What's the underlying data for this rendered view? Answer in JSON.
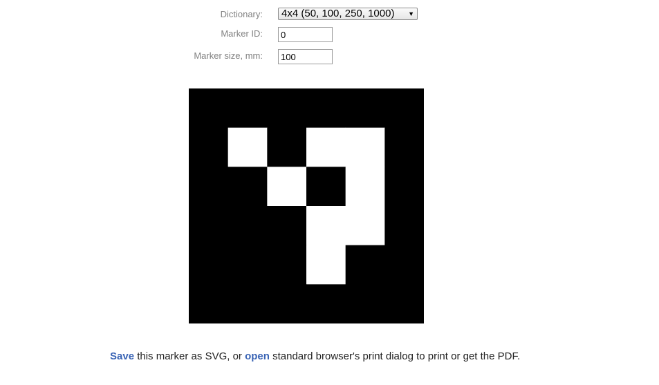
{
  "form": {
    "dictionary_label": "Dictionary:",
    "dictionary_value": "4x4 (50, 100, 250, 1000)",
    "marker_id_label": "Marker ID:",
    "marker_id_value": "0",
    "marker_size_label": "Marker size, mm:",
    "marker_size_value": "100"
  },
  "marker": {
    "grid_size": 6,
    "cells": [
      [
        1,
        1,
        1,
        1,
        1,
        1
      ],
      [
        1,
        0,
        1,
        0,
        0,
        1
      ],
      [
        1,
        1,
        0,
        1,
        0,
        1
      ],
      [
        1,
        1,
        1,
        0,
        0,
        1
      ],
      [
        1,
        1,
        1,
        0,
        1,
        1
      ],
      [
        1,
        1,
        1,
        1,
        1,
        1
      ]
    ],
    "foreground_color": "#000000",
    "background_color": "#ffffff"
  },
  "footer": {
    "save_link": "Save",
    "text_middle": " this marker as SVG, or ",
    "open_link": "open",
    "text_end": " standard browser's print dialog to print or get the PDF."
  }
}
